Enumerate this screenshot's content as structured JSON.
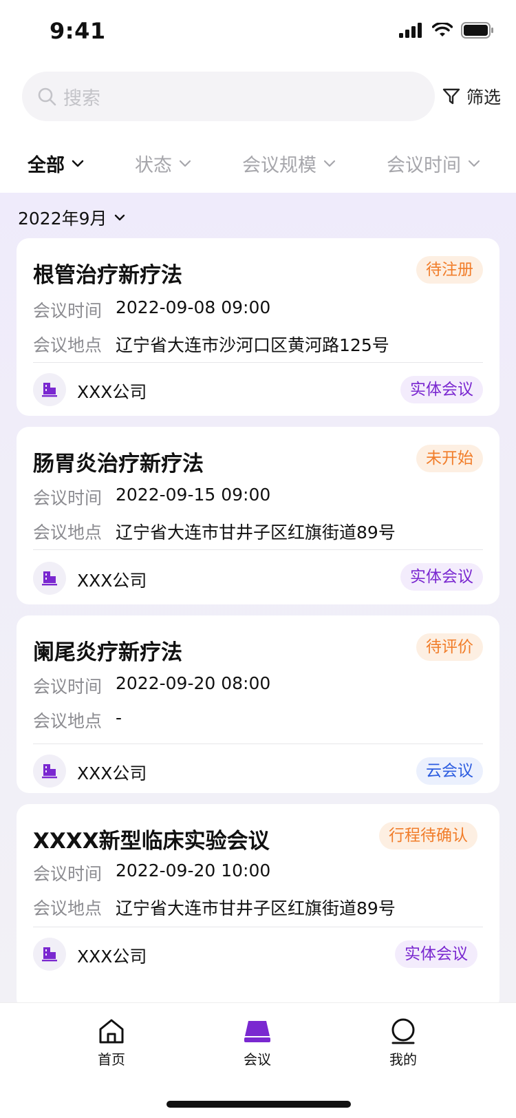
{
  "status_bar": {
    "time": "9:41"
  },
  "search": {
    "placeholder": "搜索",
    "filter_label": "筛选"
  },
  "tabs": [
    {
      "label": "全部",
      "active": true
    },
    {
      "label": "状态",
      "active": false
    },
    {
      "label": "会议规模",
      "active": false
    },
    {
      "label": "会议时间",
      "active": false
    }
  ],
  "month": "2022年9月",
  "labels": {
    "time_key": "会议时间",
    "place_key": "会议地点"
  },
  "meetings": [
    {
      "title": "根管治疗新疗法",
      "status": "待注册",
      "time": "2022-09-08 09:00",
      "place": "辽宁省大连市沙河口区黄河路125号",
      "org": "XXX公司",
      "type": "实体会议"
    },
    {
      "title": "肠胃炎治疗新疗法",
      "status": "未开始",
      "time": "2022-09-15 09:00",
      "place": "辽宁省大连市甘井子区红旗街道89号",
      "org": "XXX公司",
      "type": "实体会议"
    },
    {
      "title": "阑尾炎疗新疗法",
      "status": "待评价",
      "time": "2022-09-20 08:00",
      "place": "-",
      "org": "XXX公司",
      "type": "云会议"
    },
    {
      "title": "XXXX新型临床实验会议",
      "status": "行程待确认",
      "time": "2022-09-20 10:00",
      "place": "辽宁省大连市甘井子区红旗街道89号",
      "org": "XXX公司",
      "type": "实体会议"
    }
  ],
  "nav": [
    {
      "label": "首页",
      "icon": "home-icon",
      "active": false
    },
    {
      "label": "会议",
      "icon": "meeting-icon",
      "active": true
    },
    {
      "label": "我的",
      "icon": "profile-icon",
      "active": false
    }
  ],
  "colors": {
    "accent": "#7a28d0",
    "status_orange": "#f17d2a",
    "cloud_blue": "#2d5de0"
  }
}
